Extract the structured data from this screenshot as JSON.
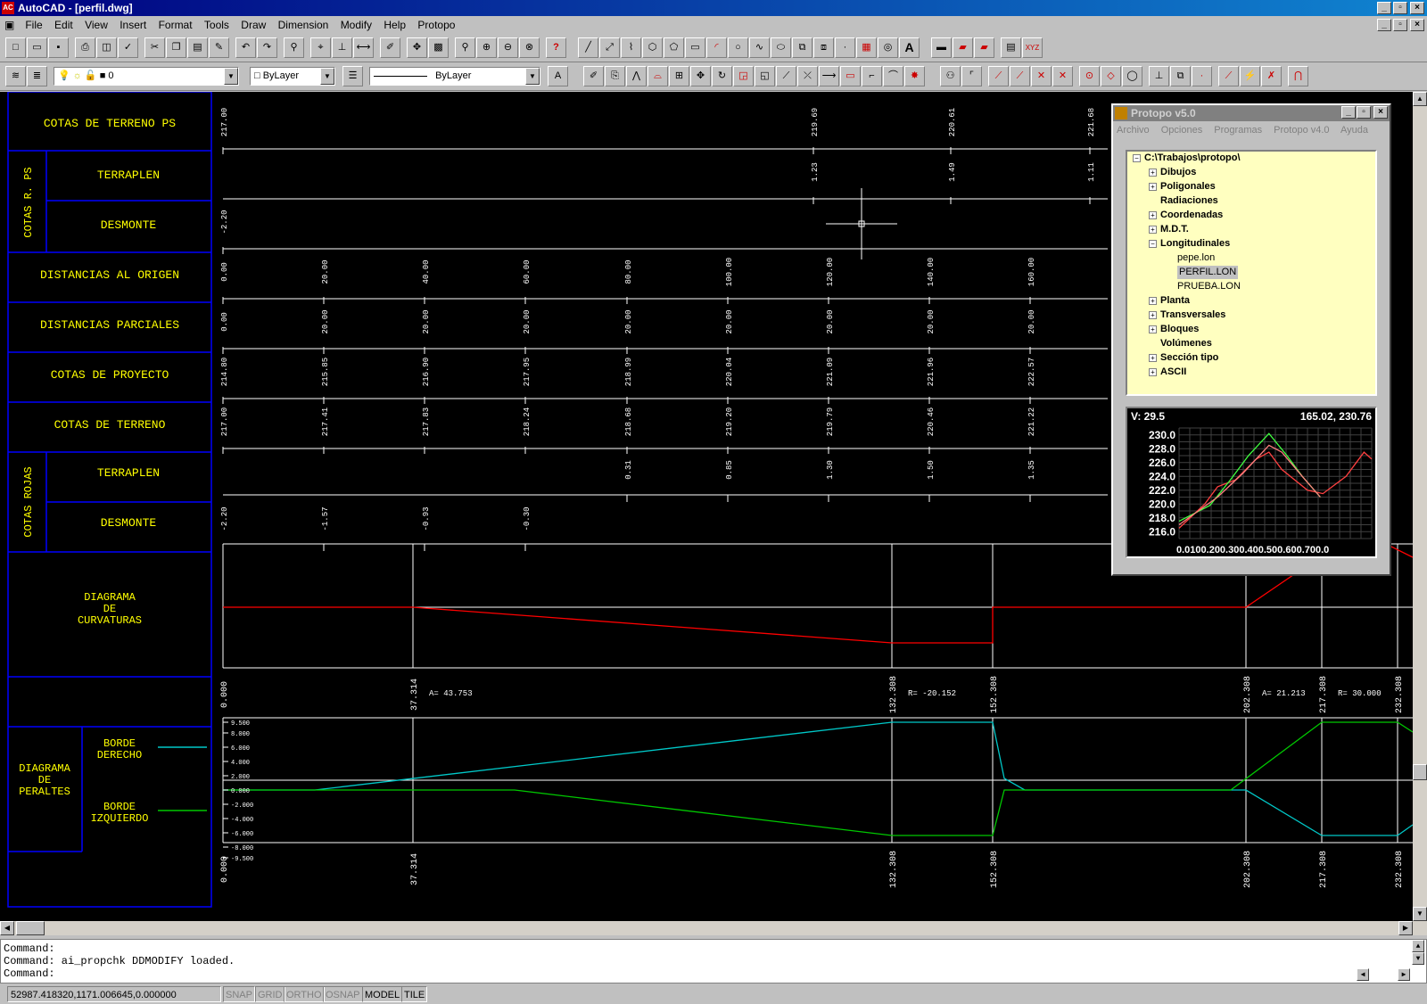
{
  "window": {
    "title": "AutoCAD - [perfil.dwg]",
    "icon": "autocad-icon"
  },
  "menu": [
    "File",
    "Edit",
    "View",
    "Insert",
    "Format",
    "Tools",
    "Draw",
    "Dimension",
    "Modify",
    "Help",
    "Protopo"
  ],
  "layer_toolbar": {
    "layer_value": "0",
    "color_value": "ByLayer",
    "linetype_value": "ByLayer"
  },
  "profile": {
    "rows": {
      "cotas_terreno_ps": "COTAS DE TERRENO PS",
      "cotas_r_ps": "COTAS R. PS",
      "terraplen": "TERRAPLEN",
      "desmonte": "DESMONTE",
      "distancias_origen": "DISTANCIAS AL ORIGEN",
      "distancias_parciales": "DISTANCIAS PARCIALES",
      "cotas_proyecto": "COTAS DE PROYECTO",
      "cotas_terreno": "COTAS DE TERRENO",
      "cotas_rojas": "COTAS ROJAS",
      "diagrama_curvaturas_1": "DIAGRAMA",
      "diagrama_curvaturas_2": "DE",
      "diagrama_curvaturas_3": "CURVATURAS",
      "diagrama_peraltes_1": "DIAGRAMA",
      "diagrama_peraltes_2": "DE",
      "diagrama_peraltes_3": "PERALTES",
      "borde_derecho_1": "BORDE",
      "borde_derecho_2": "DERECHO",
      "borde_izquierdo_1": "BORDE",
      "borde_izquierdo_2": "IZQUIERDO"
    },
    "cotas_terreno_ps": [
      "217.00",
      "219.69",
      "220.61",
      "221.68"
    ],
    "cotas_r_ps_terraplen": [
      "1.23",
      "1.49",
      "1.11"
    ],
    "cotas_r_ps_desmonte": [
      "-2.20"
    ],
    "distancias_origen": [
      "0.00",
      "20.00",
      "40.00",
      "60.00",
      "80.00",
      "100.00",
      "120.00",
      "140.00",
      "160.00"
    ],
    "distancias_parciales": [
      "0.00",
      "20.00",
      "20.00",
      "20.00",
      "20.00",
      "20.00",
      "20.00",
      "20.00",
      "20.00"
    ],
    "cotas_proyecto": [
      "214.80",
      "215.85",
      "216.90",
      "217.95",
      "218.99",
      "220.04",
      "221.09",
      "221.96",
      "222.57"
    ],
    "cotas_terreno": [
      "217.00",
      "217.41",
      "217.83",
      "218.24",
      "218.68",
      "219.20",
      "219.79",
      "220.46",
      "221.22"
    ],
    "cotas_rojas_terraplen": [
      "0.31",
      "0.85",
      "1.30",
      "1.50",
      "1.35"
    ],
    "cotas_rojas_desmonte": [
      "-2.20",
      "-1.57",
      "-0.93",
      "-0.30"
    ],
    "curv_stations": [
      "0.000",
      "37.314",
      "132.308",
      "152.308",
      "202.308",
      "217.308",
      "232.308"
    ],
    "curv_labels": {
      "a1": "A= 43.753",
      "r1": "R= -20.152",
      "a2": "A= 21.213",
      "r2": "R= 30.000"
    },
    "peralte_ticks": [
      "9.500",
      "8.000",
      "6.000",
      "4.000",
      "2.000",
      "0.000",
      "-2.000",
      "-4.000",
      "-6.000",
      "-8.000",
      "-9.500"
    ],
    "colors": {
      "label": "#ffff00",
      "frame": "#0000ff",
      "curvature": "#ff0000",
      "right_edge": "#00c8c8",
      "left_edge": "#00c800",
      "white": "#ffffff"
    }
  },
  "protopo": {
    "title": "Protopo v5.0",
    "menu": [
      "Archivo",
      "Opciones",
      "Programas",
      "Protopo v4.0",
      "Ayuda"
    ],
    "tree": {
      "root": "C:\\Trabajos\\protopo\\",
      "items": [
        "Dibujos",
        "Poligonales",
        "Radiaciones",
        "Coordenadas",
        "M.D.T.",
        "Longitudinales",
        "pepe.lon",
        "PERFIL.LON",
        "PRUEBA.LON",
        "Planta",
        "Transversales",
        "Bloques",
        "Volúmenes",
        "Sección tipo",
        "ASCII"
      ]
    },
    "chart_header": {
      "v": "V: 29.5",
      "coords": "165.02, 230.76"
    },
    "chart_data": {
      "type": "line",
      "yticks": [
        "230.0",
        "228.0",
        "226.0",
        "224.0",
        "222.0",
        "220.0",
        "218.0",
        "216.0"
      ],
      "xticks": "0.0100.200.300.400.500.600.700.0",
      "ylim": [
        215,
        231
      ],
      "xlim": [
        0,
        750
      ],
      "series": [
        {
          "color": "#ff4040",
          "x": [
            0,
            100,
            150,
            220,
            300,
            350,
            400,
            500,
            560,
            650,
            720,
            750
          ],
          "y": [
            216.5,
            220,
            222.5,
            223.5,
            226.5,
            227.5,
            225,
            222,
            221.5,
            224,
            227.5,
            226.5
          ]
        },
        {
          "color": "#40ff40",
          "x": [
            0,
            120,
            200,
            270,
            350,
            420,
            480,
            550
          ],
          "y": [
            217.5,
            219.8,
            223.5,
            227,
            230.2,
            227,
            224,
            221
          ]
        },
        {
          "color": "#ff8080",
          "x": [
            0,
            150,
            250,
            350,
            400,
            480,
            550
          ],
          "y": [
            217,
            221,
            224.5,
            228.5,
            227.5,
            224,
            221
          ]
        }
      ]
    }
  },
  "command": {
    "lines": [
      "Command:",
      "Command: ai_propchk   DDMODIFY loaded.",
      "Command:"
    ]
  },
  "status": {
    "coords": "52987.418320,1171.006645,0.000000",
    "toggles": [
      "SNAP",
      "GRID",
      "ORTHO",
      "OSNAP",
      "MODEL",
      "TILE"
    ]
  }
}
